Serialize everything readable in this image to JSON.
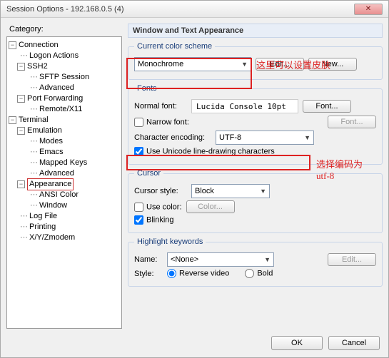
{
  "window": {
    "title": "Session Options - 192.168.0.5 (4)"
  },
  "category_label": "Category:",
  "tree": {
    "connection": "Connection",
    "logon_actions": "Logon Actions",
    "ssh2": "SSH2",
    "sftp_session": "SFTP Session",
    "advanced1": "Advanced",
    "port_forwarding": "Port Forwarding",
    "remote_x11": "Remote/X11",
    "terminal": "Terminal",
    "emulation": "Emulation",
    "modes": "Modes",
    "emacs": "Emacs",
    "mapped_keys": "Mapped Keys",
    "advanced2": "Advanced",
    "appearance": "Appearance",
    "ansi_color": "ANSI Color",
    "window_item": "Window",
    "log_file": "Log File",
    "printing": "Printing",
    "xyzmodem": "X/Y/Zmodem"
  },
  "section": {
    "title": "Window and Text Appearance"
  },
  "scheme": {
    "legend": "Current color scheme",
    "value": "Monochrome",
    "edit": "Edit...",
    "new": "New..."
  },
  "fonts": {
    "legend": "Fonts",
    "normal_label": "Normal font:",
    "normal_value": "Lucida Console 10pt",
    "font_btn": "Font...",
    "narrow_label": "Narrow font:",
    "encoding_label": "Character encoding:",
    "encoding_value": "UTF-8",
    "unicode_label": "Use Unicode line-drawing characters"
  },
  "cursor": {
    "legend": "Cursor",
    "style_label": "Cursor style:",
    "style_value": "Block",
    "use_color_label": "Use color:",
    "color_btn": "Color...",
    "blinking_label": "Blinking"
  },
  "highlight": {
    "legend": "Highlight keywords",
    "name_label": "Name:",
    "name_value": "<None>",
    "edit_btn": "Edit...",
    "style_label": "Style:",
    "reverse_label": "Reverse video",
    "bold_label": "Bold"
  },
  "annotations": {
    "a1": "这里可以设置皮肤",
    "a2": "选择编码为utf-8"
  },
  "footer": {
    "ok": "OK",
    "cancel": "Cancel"
  }
}
